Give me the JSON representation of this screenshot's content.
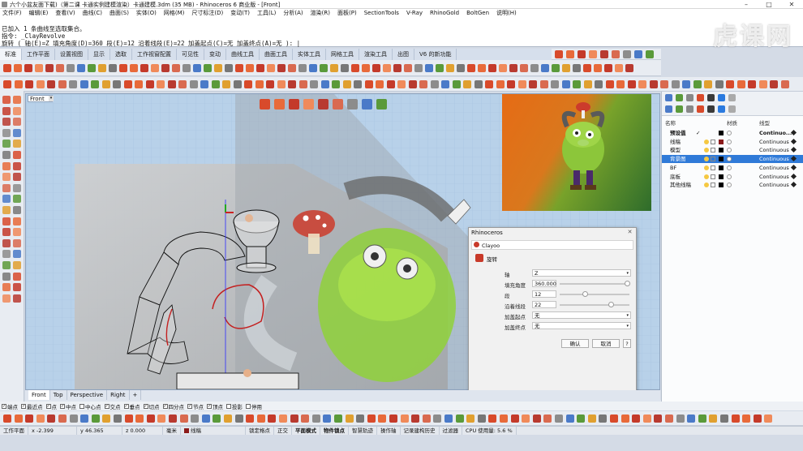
{
  "window": {
    "title": "六个小盆友面下载)（第二课 卡通实例建模渲染）卡通建模.3dm (35 MB) - Rhinoceros 6 商业版 - [Front]"
  },
  "menu": [
    "文件(F)",
    "编辑(E)",
    "查看(V)",
    "曲线(C)",
    "曲面(S)",
    "实体(O)",
    "网格(M)",
    "尺寸标注(D)",
    "变动(T)",
    "工具(L)",
    "分析(A)",
    "渲染(R)",
    "面板(P)",
    "SectionTools",
    "V-Ray",
    "RhinoGold",
    "BoltGen",
    "说明(H)"
  ],
  "command": {
    "line1": "已加入 1 条曲线至选取集合。",
    "line2": "指令: _ClayRevolve",
    "line3": "旋转 ( 轴(E)=Z  填充角度(D)=360  段(E)=12  沿着线段(E)=22  加盖起点(C)=无  加盖终点(A)=无 ): |"
  },
  "watermark": "虎课网",
  "tabs": [
    "标准",
    "工作平面",
    "设置视图",
    "显示",
    "选取",
    "工作视窗配置",
    "可见性",
    "变动",
    "曲线工具",
    "曲面工具",
    "实体工具",
    "网格工具",
    "渲染工具",
    "出图",
    "V6 的新功能"
  ],
  "viewport": {
    "label": "Front",
    "tabs": [
      "Front",
      "Top",
      "Perspective",
      "Right"
    ]
  },
  "layers": {
    "headers": {
      "name": "名称",
      "material": "材质",
      "linetype": "线型"
    },
    "rows": [
      {
        "name": "预设值",
        "check": "✓",
        "color": "#000000",
        "linetype": "Continuo..."
      },
      {
        "name": "线稿",
        "check": "",
        "color": "#8b1a1a",
        "linetype": "Continuous"
      },
      {
        "name": "模型",
        "check": "",
        "color": "#000000",
        "linetype": "Continuous"
      },
      {
        "name": "背景图",
        "check": "",
        "color": "#000000",
        "linetype": "Continuous"
      },
      {
        "name": "BF",
        "check": "",
        "color": "#000000",
        "linetype": "Continuous"
      },
      {
        "name": "底板",
        "check": "",
        "color": "#000000",
        "linetype": "Continuous"
      },
      {
        "name": "其他线稿",
        "check": "",
        "color": "#000000",
        "linetype": "Continuous"
      }
    ]
  },
  "dialog": {
    "title": "Rhinoceros",
    "plugin": "Clayoo",
    "command": "旋转",
    "fields": [
      {
        "label": "轴",
        "value": "Z",
        "kind": "select"
      },
      {
        "label": "填充角度",
        "value": "360.000",
        "kind": "slider",
        "level": 1.0
      },
      {
        "label": "段",
        "value": "12",
        "kind": "slider",
        "level": 0.35
      },
      {
        "label": "沿着线段",
        "value": "22",
        "kind": "slider",
        "level": 0.75
      },
      {
        "label": "加盖起点",
        "value": "无",
        "kind": "select"
      },
      {
        "label": "加盖终点",
        "value": "无",
        "kind": "select"
      }
    ],
    "ok": "确认",
    "cancel": "取消",
    "help": "?"
  },
  "osnap": [
    "端点",
    "最近点",
    "点",
    "中点",
    "中心点",
    "交点",
    "垂点",
    "切点",
    "四分点",
    "节点",
    "顶点",
    "投影",
    "停用"
  ],
  "osnap_checked": [
    true,
    true,
    true,
    true,
    false,
    true,
    true,
    true,
    true,
    true,
    true,
    false,
    false
  ],
  "status": {
    "cplane": "工作平面",
    "x": "x -2.399",
    "y": "y 46.365",
    "z": "z 0.000",
    "unit": "毫米",
    "layer": "线稿",
    "items": [
      "锁定格点",
      "正交",
      "平面模式",
      "物件锁点",
      "智慧轨迹",
      "操作轴",
      "记录建构历史",
      "过滤器",
      "CPU 使用量: 5.6 %"
    ]
  }
}
